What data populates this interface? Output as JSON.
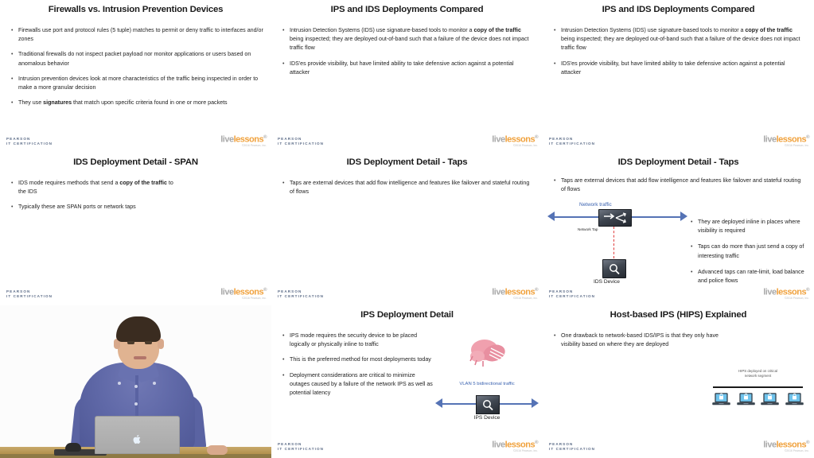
{
  "footer": {
    "pearson_line1": "PEARSON",
    "pearson_line2": "IT CERTIFICATION",
    "livelessons_a": "live",
    "livelessons_b": "lessons",
    "livelessons_r": "®",
    "copyright": "©2016 Pearson, Inc."
  },
  "slides": [
    {
      "id": "firewalls-vs-ips",
      "title": "Firewalls vs. Intrusion Prevention Devices",
      "bullets": [
        "Firewalls use port and protocol rules (5 tuple) matches to permit or deny traffic to interfaces and/or zones",
        "Traditional firewalls do not inspect packet payload nor monitor applications or users based on anomalous behavior",
        "Intrusion prevention devices look at more characteristics of the traffic being inspected in order to make a more granular decision",
        "They use signatures that match upon specific criteria found in one or more packets"
      ]
    },
    {
      "id": "ips-ids-compared-1",
      "title": "IPS and IDS Deployments Compared",
      "bullets": [
        "Intrusion Detection Systems (IDS) use signature-based tools to monitor a copy of the traffic being inspected; they are deployed out-of-band such that a failure of the device does not impact traffic flow",
        "IDS'es provide visibility, but have limited ability to take defensive action against a potential attacker"
      ]
    },
    {
      "id": "ips-ids-compared-2",
      "title": "IPS and IDS Deployments Compared",
      "bullets": [
        "Intrusion Detection Systems (IDS) use signature-based tools to monitor a copy of the traffic being inspected; they are deployed out-of-band such that a failure of the device does not impact traffic flow",
        "IDS'es provide visibility, but have limited ability to take defensive action against a potential attacker"
      ]
    },
    {
      "id": "ids-span",
      "title": "IDS Deployment Detail - SPAN",
      "bullets": [
        "IDS mode requires methods that send a copy of the traffic to the IDS",
        "Typically these are SPAN ports or network taps"
      ]
    },
    {
      "id": "ids-taps-1",
      "title": "IDS Deployment Detail - Taps",
      "bullets": [
        "Taps are external devices that add flow intelligence and features like failover and stateful routing of flows"
      ]
    },
    {
      "id": "ids-taps-2",
      "title": "IDS Deployment Detail - Taps",
      "bullets": [
        "Taps are external devices that add flow intelligence and features like failover and stateful routing of flows"
      ],
      "side_bullets": [
        "They are deployed inline in places where visibility is required",
        "Taps can do more than just send a copy of interesting traffic",
        "Advanced taps can rate-limit, load balance and police flows"
      ],
      "diagram": {
        "network_traffic_label": "Network traffic",
        "network_tap_label": "Network Tap",
        "ids_device_label": "IDS Device"
      }
    },
    {
      "id": "video-presenter",
      "title": ""
    },
    {
      "id": "ips-deployment-detail",
      "title": "IPS Deployment Detail",
      "bullets": [
        "IPS mode requires the security device to be placed logically or physically inline to traffic",
        "This is the preferred method for most deployments today",
        "Deployment considerations are critical to minimize outages caused by a failure of the network IPS as well as potential latency"
      ],
      "diagram": {
        "vlan_label": "VLAN 5 bidirectional traffic",
        "ips_device_label": "IPS Device"
      }
    },
    {
      "id": "hips-explained",
      "title": "Host-based IPS (HIPS) Explained",
      "bullets": [
        "One drawback to network-based IDS/IPS is that they only have visibility based on where they are deployed"
      ],
      "diagram": {
        "caption_line1": "HIPS deployed on critical",
        "caption_line2": "network segment",
        "host_count": 4
      }
    }
  ],
  "colors": {
    "accent_blue": "#3a62b0",
    "arrow_blue": "#5573b5",
    "pearson_blue": "#5b6b87",
    "livelessons_orange": "#f0a13c",
    "dashed_red": "#e03b3b"
  }
}
